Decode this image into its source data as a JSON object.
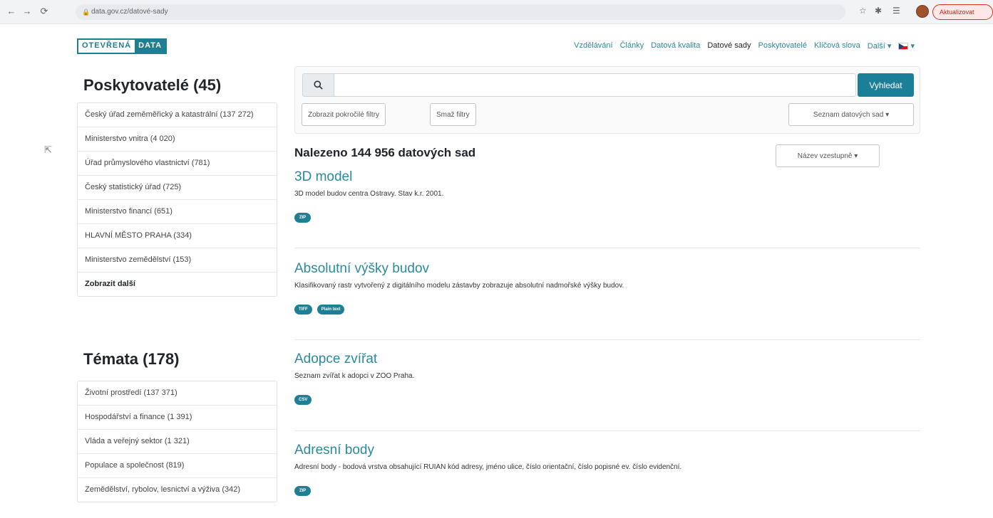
{
  "browser": {
    "url": "data.gov.cz/datové-sady",
    "update_label": "Aktualizovat"
  },
  "header": {
    "logo_part1": "OTEVŘENÁ",
    "logo_part2": "DATA",
    "nav": [
      "Vzdělávání",
      "Články",
      "Datová kvalita",
      "Datové sady",
      "Poskytovatelé",
      "Klíčová slova",
      "Další ▾"
    ],
    "nav_active_index": 3
  },
  "sidebar": {
    "providers_title": "Poskytovatelé (45)",
    "providers": [
      "Český úřad zeměměřický a katastrální (137 272)",
      "Ministerstvo vnitra (4 020)",
      "Úřad průmyslového vlastnictví (781)",
      "Český statistický úřad (725)",
      "Ministerstvo financí (651)",
      "HLAVNÍ MĚSTO PRAHA (334)",
      "Ministerstvo zemědělství (153)"
    ],
    "providers_more": "Zobrazit další",
    "topics_title": "Témata (178)",
    "topics": [
      "Životní prostředí (137 371)",
      "Hospodářství a finance (1 391)",
      "Vláda a veřejný sektor (1 321)",
      "Populace a společnost (819)",
      "Zemědělství, rybolov, lesnictví a výživa (342)"
    ]
  },
  "search": {
    "placeholder": "",
    "search_button": "Vyhledat",
    "advanced_filters": "Zobrazit pokročilé filtry",
    "clear_filters": "Smaž filtry",
    "view_mode": "Seznam datových sad ▾",
    "sort": "Název vzestupně ▾"
  },
  "results": {
    "count_label": "Nalezeno 144 956 datových sad",
    "items": [
      {
        "title": "3D model",
        "desc": "3D model budov centra Ostravy. Stav k.r. 2001.",
        "formats": [
          "ZIP"
        ]
      },
      {
        "title": "Absolutní výšky budov",
        "desc": "Klasifikovaný rastr vytvořený z digitálního modelu zástavby zobrazuje absolutní nadmořské výšky budov.",
        "formats": [
          "TIFF",
          "Plain text"
        ]
      },
      {
        "title": "Adopce zvířat",
        "desc": "Seznam zvířat k adopci v ZOO Praha.",
        "formats": [
          "CSV"
        ]
      },
      {
        "title": "Adresní body",
        "desc": "Adresní body - bodová vrstva obsahující RUIAN kód adresy, jméno ulice, číslo orientační, číslo popisné ev. číslo evidenční.",
        "formats": [
          "ZIP"
        ]
      }
    ]
  },
  "colors": {
    "accent": "#1b7f97",
    "link": "#2a8a9e"
  }
}
